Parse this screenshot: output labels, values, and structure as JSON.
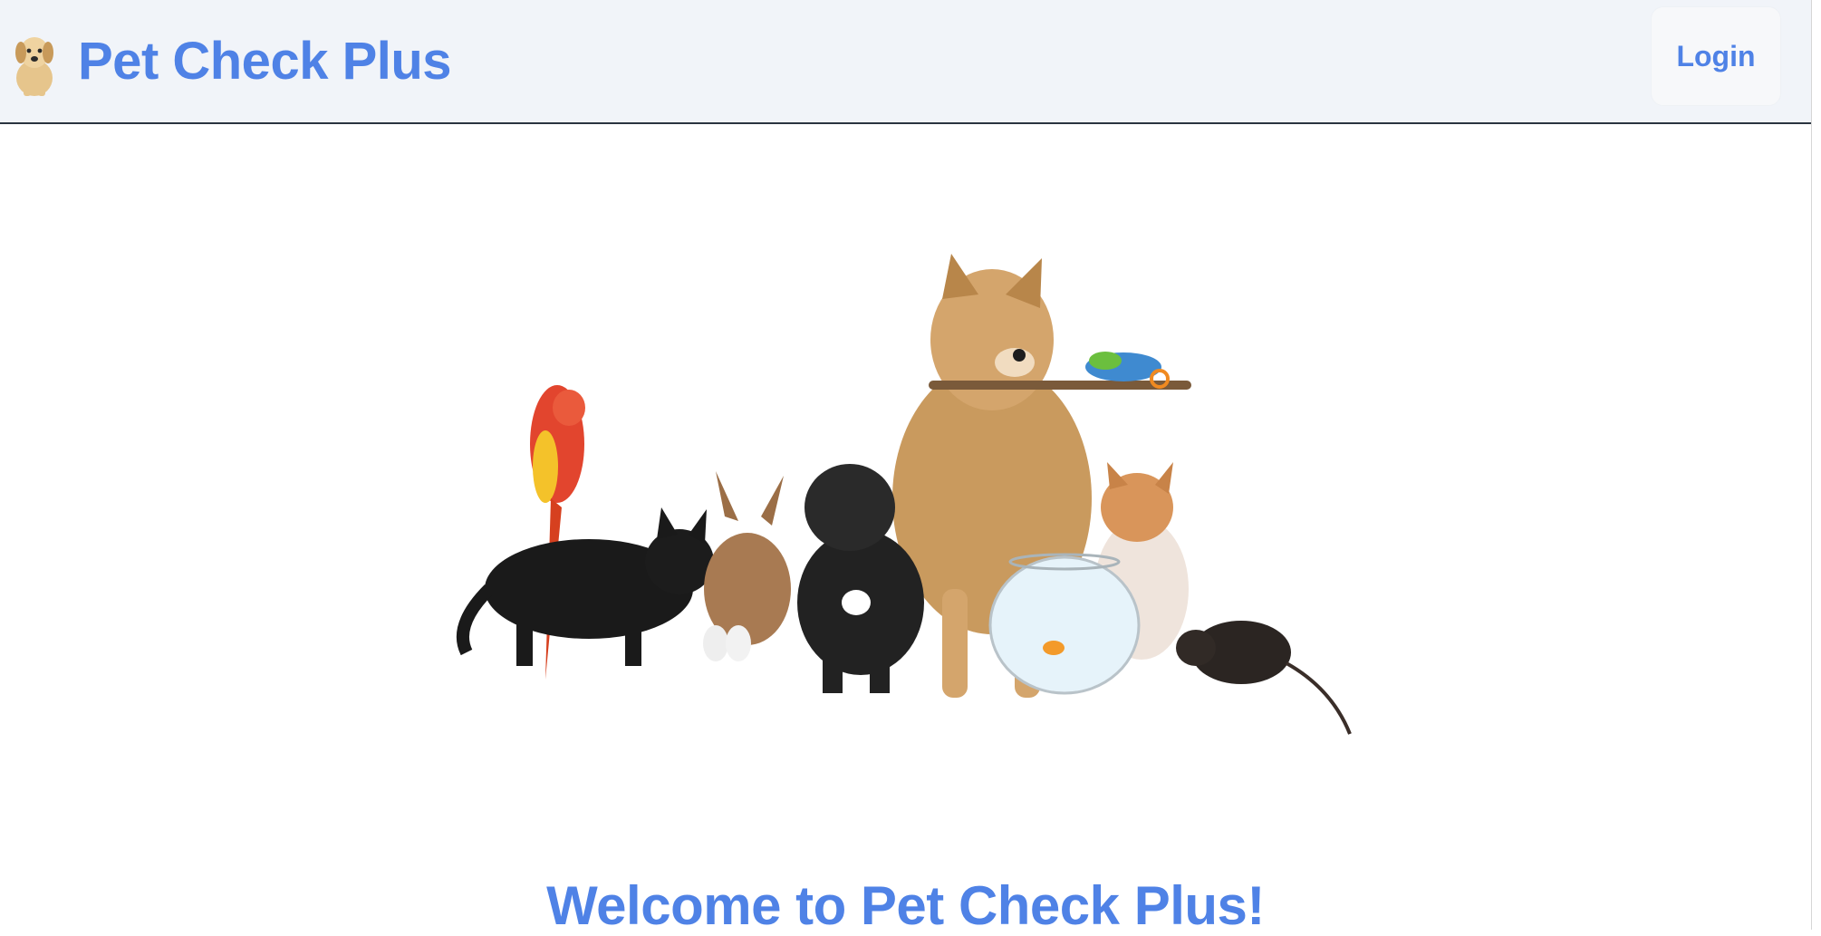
{
  "navbar": {
    "brand_text": "Pet Check Plus",
    "brand_icon": "puppy-logo-icon",
    "login_label": "Login"
  },
  "hero": {
    "image_name": "group-of-pets-image"
  },
  "main": {
    "welcome_text": "Welcome to Pet Check Plus!"
  },
  "colors": {
    "brand": "#4f82e6",
    "navbar_bg": "#f1f4f9",
    "navbar_border": "#2b3440"
  }
}
